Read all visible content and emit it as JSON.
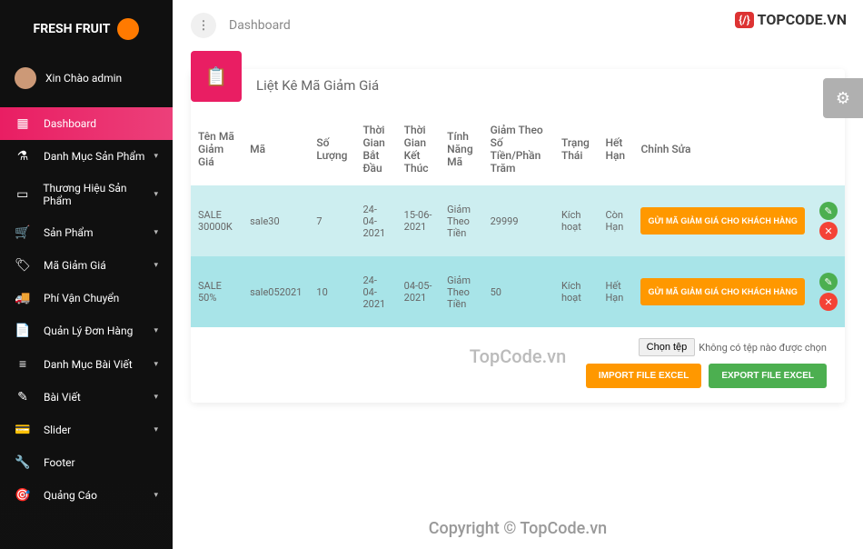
{
  "brand": "FRESH FRUIT",
  "user_greeting": "Xin Chào admin",
  "breadcrumb": "Dashboard",
  "topcode": "TOPCODE.VN",
  "sidebar": {
    "items": [
      {
        "icon": "▦",
        "label": "Dashboard",
        "expand": false,
        "active": true
      },
      {
        "icon": "⚗",
        "label": "Danh Mục Sản Phẩm",
        "expand": true
      },
      {
        "icon": "▭",
        "label": "Thương Hiệu Sản Phẩm",
        "expand": true
      },
      {
        "icon": "🛒",
        "label": "Sản Phẩm",
        "expand": true
      },
      {
        "icon": "🏷",
        "label": "Mã Giảm Giá",
        "expand": true
      },
      {
        "icon": "🚚",
        "label": "Phí Vận Chuyển",
        "expand": false
      },
      {
        "icon": "📄",
        "label": "Quản Lý Đơn Hàng",
        "expand": true
      },
      {
        "icon": "≡",
        "label": "Danh Mục Bài Viết",
        "expand": true
      },
      {
        "icon": "✎",
        "label": "Bài Viết",
        "expand": true
      },
      {
        "icon": "💳",
        "label": "Slider",
        "expand": true
      },
      {
        "icon": "🔧",
        "label": "Footer",
        "expand": false
      },
      {
        "icon": "🎯",
        "label": "Quảng Cáo",
        "expand": true
      }
    ]
  },
  "card_title": "Liệt Kê Mã Giảm Giá",
  "headers": {
    "name": "Tên Mã Giảm Giá",
    "code": "Mã",
    "qty": "Số Lượng",
    "start": "Thời Gian Bắt Đầu",
    "end": "Thời Gian Kết Thúc",
    "feat": "Tính Năng Mã",
    "discount": "Giảm Theo Số Tiền/Phần Trăm",
    "status": "Trạng Thái",
    "expire": "Hết Hạn",
    "edit": "Chỉnh Sửa"
  },
  "rows": [
    {
      "name": "SALE 30000K",
      "code": "sale30",
      "qty": "7",
      "start": "24-04-2021",
      "end": "15-06-2021",
      "feat": "Giảm Theo Tiền",
      "discount": "29999",
      "status": "Kích hoạt",
      "expire": "Còn Hạn",
      "expired": false
    },
    {
      "name": "SALE 50%",
      "code": "sale052021",
      "qty": "10",
      "start": "24-04-2021",
      "end": "04-05-2021",
      "feat": "Giảm Theo Tiền",
      "discount": "50",
      "status": "Kích hoạt",
      "expire": "Hết Hạn",
      "expired": true
    }
  ],
  "send_btn": "GỬI MÃ GIẢM GIÁ CHO KHÁCH HÀNG",
  "file": {
    "choose": "Chọn tệp",
    "none": "Không có tệp nào được chọn"
  },
  "import_btn": "IMPORT FILE EXCEL",
  "export_btn": "EXPORT FILE EXCEL",
  "watermark1": "TopCode.vn",
  "watermark2": "Copyright © TopCode.vn"
}
